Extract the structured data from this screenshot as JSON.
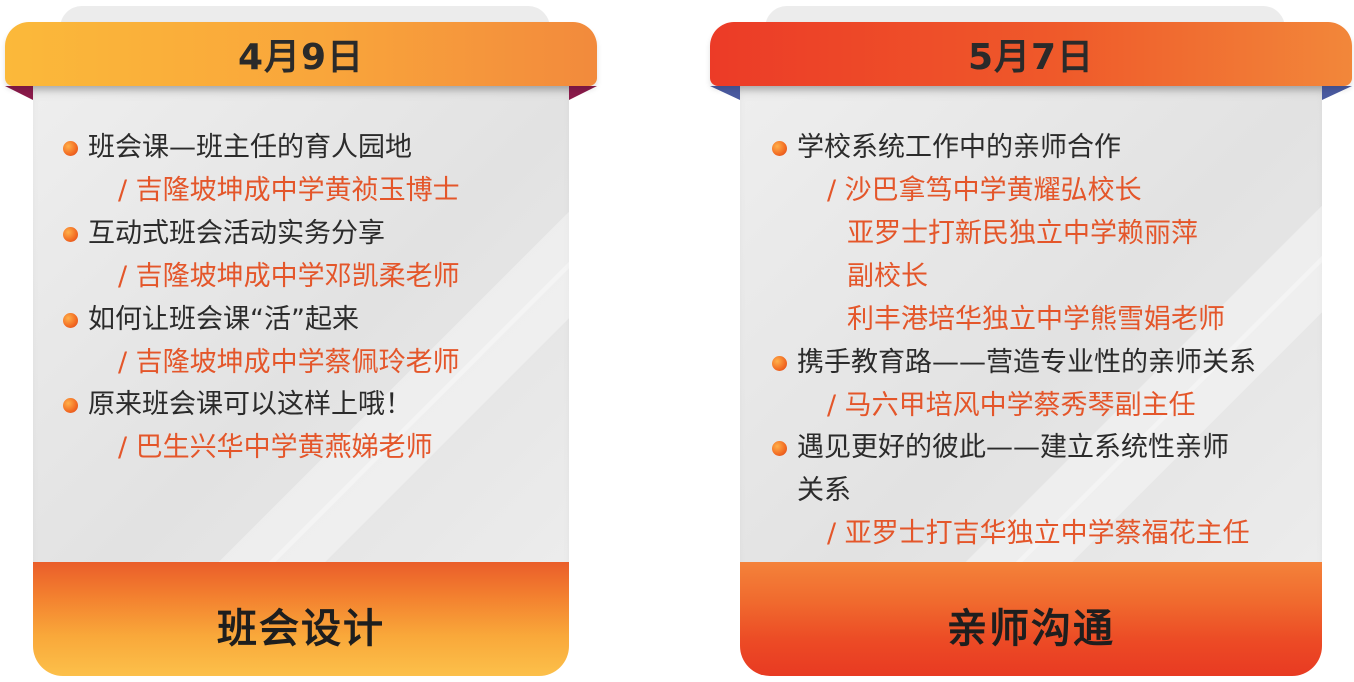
{
  "cards": [
    {
      "date": "4月9日",
      "title": "班会设计",
      "lines": [
        {
          "kind": "topic",
          "text": "班会课—班主任的育人园地"
        },
        {
          "kind": "speaker",
          "text": "/ 吉隆坡坤成中学黄祯玉博士"
        },
        {
          "kind": "topic",
          "text": "互动式班会活动实务分享"
        },
        {
          "kind": "speaker",
          "text": "/ 吉隆坡坤成中学邓凯柔老师"
        },
        {
          "kind": "topic",
          "text": "如何让班会课“活”起来"
        },
        {
          "kind": "speaker",
          "text": "/ 吉隆坡坤成中学蔡佩玲老师"
        },
        {
          "kind": "topic",
          "text": "原来班会课可以这样上哦！"
        },
        {
          "kind": "speaker",
          "text": "/ 巴生兴华中学黄燕娣老师"
        }
      ]
    },
    {
      "date": "5月7日",
      "title": "亲师沟通",
      "lines": [
        {
          "kind": "topic",
          "text": "学校系统工作中的亲师合作"
        },
        {
          "kind": "speaker",
          "text": "/ 沙巴拿笃中学黄耀弘校长"
        },
        {
          "kind": "speaker-cont",
          "text": "亚罗士打新民独立中学赖丽萍"
        },
        {
          "kind": "speaker-cont",
          "text": "副校长"
        },
        {
          "kind": "speaker-cont",
          "text": "利丰港培华独立中学熊雪娟老师"
        },
        {
          "kind": "topic",
          "text": "携手教育路——营造专业性的亲师关系"
        },
        {
          "kind": "speaker",
          "text": "/ 马六甲培风中学蔡秀琴副主任"
        },
        {
          "kind": "topic",
          "text": "遇见更好的彼此——建立系统性亲师"
        },
        {
          "kind": "topic-cont",
          "text": "关系"
        },
        {
          "kind": "speaker",
          "text": "/ 亚罗士打吉华独立中学蔡福花主任"
        }
      ]
    }
  ],
  "colors": {
    "topic_text": "#2b2b2b",
    "speaker_text": "#e4562a",
    "left_accent": "#f9a53b",
    "right_accent": "#ec3b27"
  },
  "icons": {
    "bullet": "orange-dot-bullet"
  }
}
